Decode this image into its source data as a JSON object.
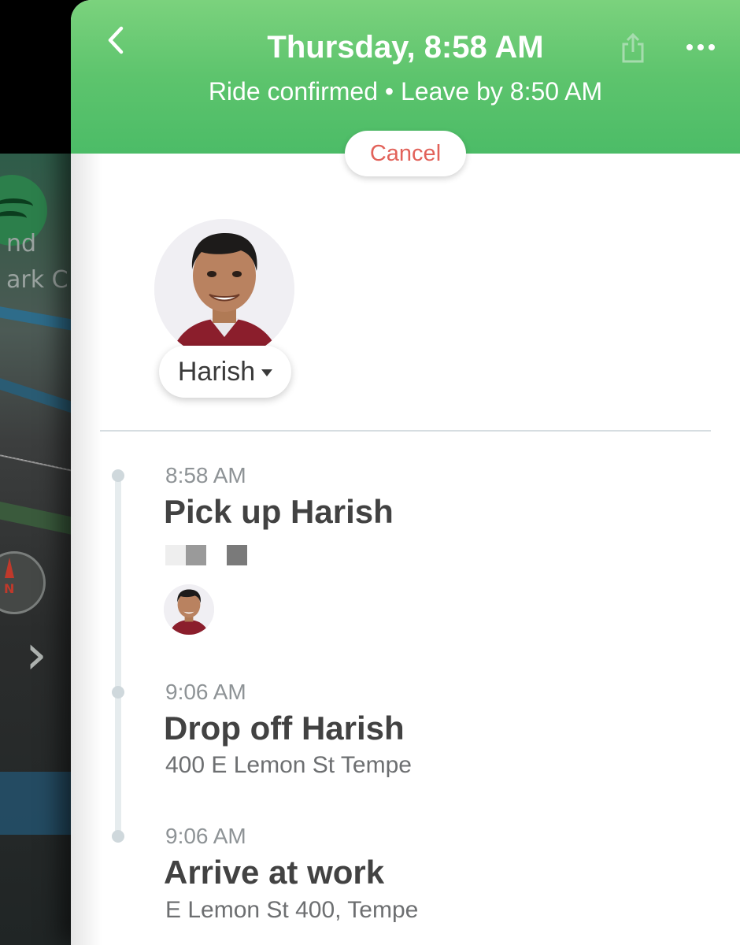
{
  "header": {
    "title": "Thursday, 8:58 AM",
    "subtitle": "Ride confirmed • Leave by 8:50 AM",
    "cancel_label": "Cancel"
  },
  "rider": {
    "name": "Harish"
  },
  "stops": [
    {
      "time": "8:58 AM",
      "title": "Pick up Harish"
    },
    {
      "time": "9:06 AM",
      "title": "Drop off Harish",
      "address": "400 E Lemon St Tempe"
    },
    {
      "time": "9:06 AM",
      "title": "Arrive at work",
      "address": "E Lemon St 400, Tempe"
    }
  ],
  "background_map": {
    "labels": [
      "nd",
      "ark C"
    ]
  },
  "colors": {
    "header_green": "#5dc46d",
    "cancel_red": "#e2625a",
    "title_text": "#424242",
    "time_text": "#8e9396"
  },
  "icons": [
    "back-chevron-icon",
    "share-icon",
    "more-icon",
    "caret-down-icon",
    "spotify-icon",
    "compass-icon",
    "chevron-right-icon"
  ]
}
